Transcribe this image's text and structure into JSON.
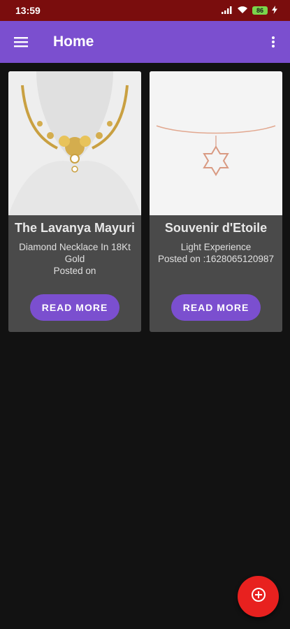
{
  "status_bar": {
    "time": "13:59",
    "battery": "86"
  },
  "app_bar": {
    "title": "Home",
    "menu_icon": "hamburger-menu-icon",
    "overflow_icon": "more-vertical-icon"
  },
  "cards": [
    {
      "title": "The Lavanya Mayuri",
      "description": "Diamond Necklace In 18Kt Gold",
      "posted": "Posted on",
      "button": "READ MORE"
    },
    {
      "title": "Souvenir d'Etoile",
      "description": "Light Experience",
      "posted": "Posted on :1628065120987",
      "button": "READ MORE"
    }
  ],
  "fab": {
    "icon": "add-circle-icon"
  },
  "colors": {
    "primary": "#7b4fcf",
    "status_bar": "#7a0d0d",
    "card_bg": "#4a4a4a",
    "background": "#121212",
    "fab": "#e8211f"
  }
}
